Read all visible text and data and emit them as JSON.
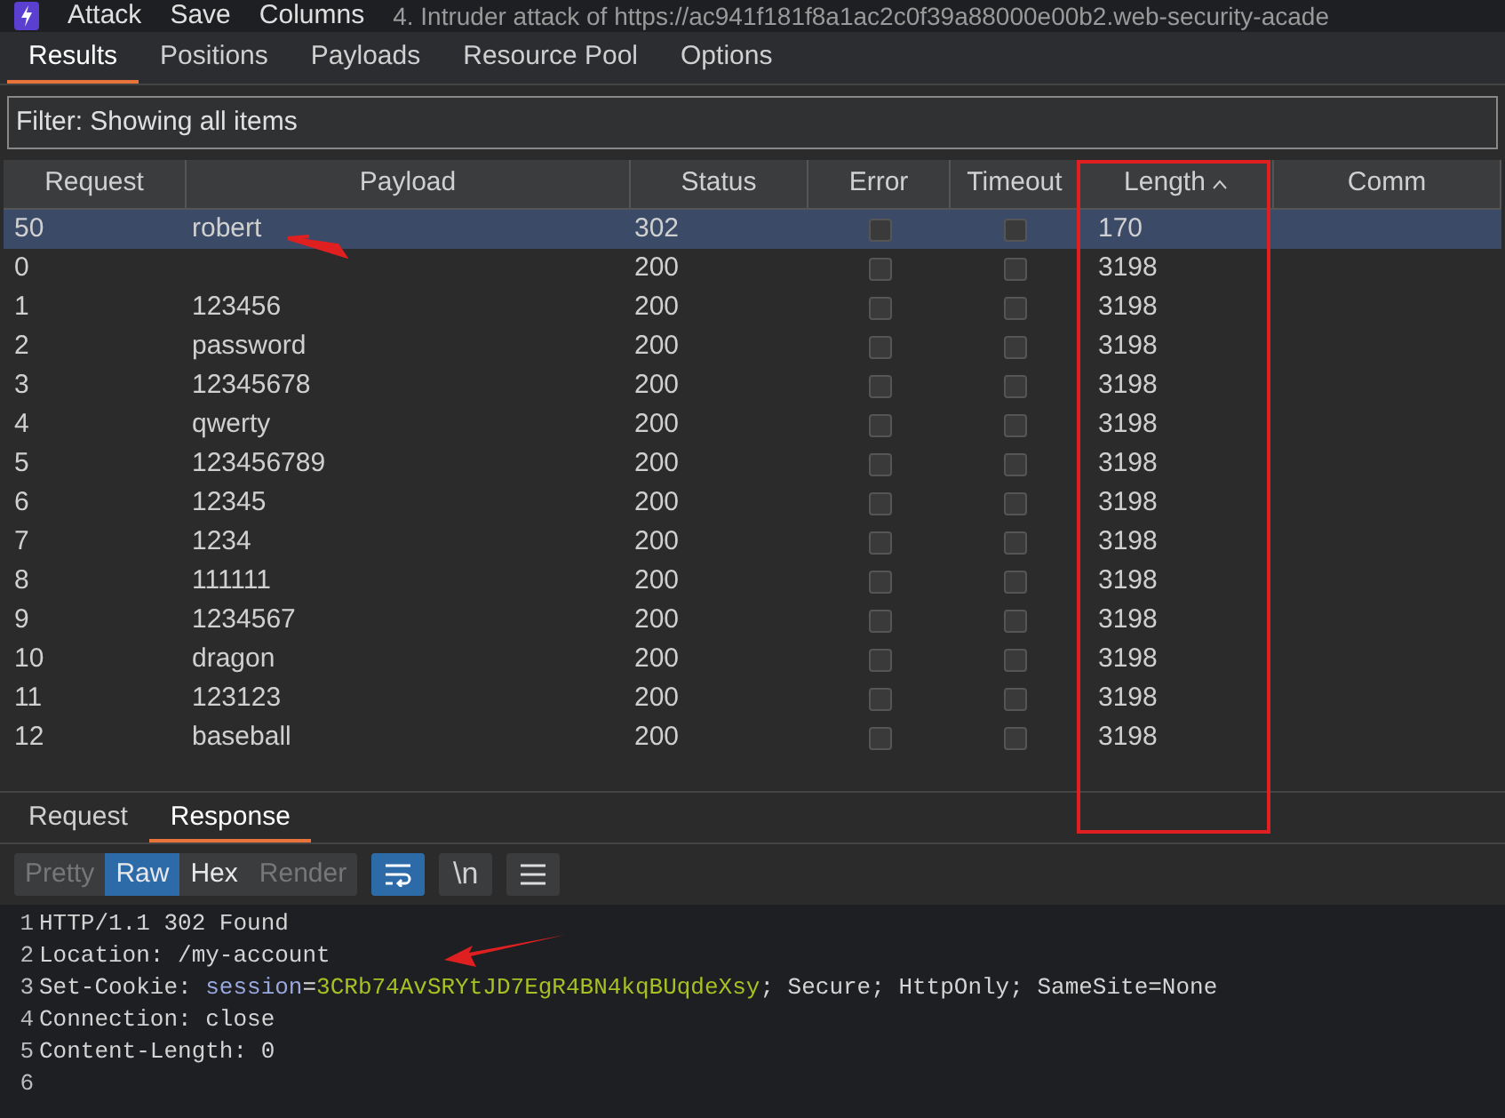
{
  "menu": {
    "items": [
      "Attack",
      "Save",
      "Columns"
    ],
    "title": "4. Intruder attack of https://ac941f181f8a1ac2c0f39a88000e00b2.web-security-acade"
  },
  "tabs": [
    {
      "label": "Results",
      "selected": true
    },
    {
      "label": "Positions",
      "selected": false
    },
    {
      "label": "Payloads",
      "selected": false
    },
    {
      "label": "Resource Pool",
      "selected": false
    },
    {
      "label": "Options",
      "selected": false
    }
  ],
  "filter": {
    "value": "Filter: Showing all items"
  },
  "table": {
    "columns": [
      {
        "label": "Request",
        "sorted": false
      },
      {
        "label": "Payload",
        "sorted": false
      },
      {
        "label": "Status",
        "sorted": false
      },
      {
        "label": "Error",
        "sorted": false
      },
      {
        "label": "Timeout",
        "sorted": false
      },
      {
        "label": "Length",
        "sorted": true
      },
      {
        "label": "Comm",
        "sorted": false
      }
    ],
    "rows": [
      {
        "request": "50",
        "payload": "robert",
        "status": "302",
        "error": false,
        "timeout": false,
        "length": "170",
        "selected": true
      },
      {
        "request": "0",
        "payload": "",
        "status": "200",
        "error": false,
        "timeout": false,
        "length": "3198",
        "selected": false
      },
      {
        "request": "1",
        "payload": "123456",
        "status": "200",
        "error": false,
        "timeout": false,
        "length": "3198",
        "selected": false
      },
      {
        "request": "2",
        "payload": "password",
        "status": "200",
        "error": false,
        "timeout": false,
        "length": "3198",
        "selected": false
      },
      {
        "request": "3",
        "payload": "12345678",
        "status": "200",
        "error": false,
        "timeout": false,
        "length": "3198",
        "selected": false
      },
      {
        "request": "4",
        "payload": "qwerty",
        "status": "200",
        "error": false,
        "timeout": false,
        "length": "3198",
        "selected": false
      },
      {
        "request": "5",
        "payload": "123456789",
        "status": "200",
        "error": false,
        "timeout": false,
        "length": "3198",
        "selected": false
      },
      {
        "request": "6",
        "payload": "12345",
        "status": "200",
        "error": false,
        "timeout": false,
        "length": "3198",
        "selected": false
      },
      {
        "request": "7",
        "payload": "1234",
        "status": "200",
        "error": false,
        "timeout": false,
        "length": "3198",
        "selected": false
      },
      {
        "request": "8",
        "payload": "111111",
        "status": "200",
        "error": false,
        "timeout": false,
        "length": "3198",
        "selected": false
      },
      {
        "request": "9",
        "payload": "1234567",
        "status": "200",
        "error": false,
        "timeout": false,
        "length": "3198",
        "selected": false
      },
      {
        "request": "10",
        "payload": "dragon",
        "status": "200",
        "error": false,
        "timeout": false,
        "length": "3198",
        "selected": false
      },
      {
        "request": "11",
        "payload": "123123",
        "status": "200",
        "error": false,
        "timeout": false,
        "length": "3198",
        "selected": false
      },
      {
        "request": "12",
        "payload": "baseball",
        "status": "200",
        "error": false,
        "timeout": false,
        "length": "3198",
        "selected": false
      }
    ]
  },
  "message_tabs": [
    {
      "label": "Request",
      "selected": false
    },
    {
      "label": "Response",
      "selected": true
    }
  ],
  "view_modes": [
    {
      "label": "Pretty",
      "selected": false,
      "disabled": true
    },
    {
      "label": "Raw",
      "selected": true,
      "disabled": false
    },
    {
      "label": "Hex",
      "selected": false,
      "disabled": false
    },
    {
      "label": "Render",
      "selected": false,
      "disabled": true
    }
  ],
  "tools": [
    {
      "kind": "wrap",
      "selected": true
    },
    {
      "kind": "newline",
      "label": "\\n",
      "selected": false
    },
    {
      "kind": "menu",
      "selected": false
    }
  ],
  "code_lines": [
    {
      "number": "1",
      "segments": [
        {
          "kind": "plain",
          "text": "HTTP/1.1 302 Found"
        }
      ]
    },
    {
      "number": "2",
      "segments": [
        {
          "kind": "plain",
          "text": "Location: /my-account"
        }
      ]
    },
    {
      "number": "3",
      "segments": [
        {
          "kind": "plain",
          "text": "Set-Cookie: "
        },
        {
          "kind": "key",
          "text": "session"
        },
        {
          "kind": "plain",
          "text": "="
        },
        {
          "kind": "value",
          "text": "3CRb74AvSRYtJD7EgR4BN4kqBUqdeXsy"
        },
        {
          "kind": "plain",
          "text": "; Secure; HttpOnly; SameSite=None"
        }
      ]
    },
    {
      "number": "4",
      "segments": [
        {
          "kind": "plain",
          "text": "Connection: close"
        }
      ]
    },
    {
      "number": "5",
      "segments": [
        {
          "kind": "plain",
          "text": "Content-Length: 0"
        }
      ]
    },
    {
      "number": "6"
    }
  ]
}
